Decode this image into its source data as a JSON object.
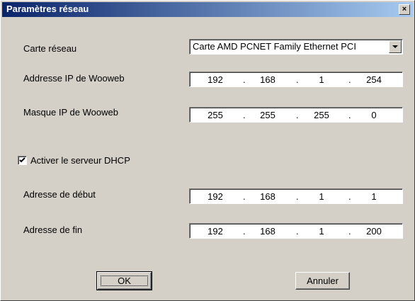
{
  "window": {
    "title": "Paramètres réseau",
    "close_glyph": "×"
  },
  "network_card": {
    "label": "Carte réseau",
    "value": "Carte AMD PCNET Family Ethernet PCI"
  },
  "ip_address": {
    "label": "Addresse IP de Wooweb",
    "octets": [
      "192",
      "168",
      "1",
      "254"
    ]
  },
  "ip_mask": {
    "label": "Masque IP de Wooweb",
    "octets": [
      "255",
      "255",
      "255",
      "0"
    ]
  },
  "dhcp": {
    "label": "Activer le serveur DHCP",
    "checked": true
  },
  "start_address": {
    "label": "Adresse de début",
    "octets": [
      "192",
      "168",
      "1",
      "1"
    ]
  },
  "end_address": {
    "label": "Adresse de fin",
    "octets": [
      "192",
      "168",
      "1",
      "200"
    ]
  },
  "buttons": {
    "ok": "OK",
    "cancel": "Annuler"
  },
  "icons": {
    "close": "close-icon",
    "dropdown": "chevron-down-icon",
    "check": "check-icon"
  },
  "colors": {
    "titlebar_start": "#0a246a",
    "titlebar_end": "#a6caf0",
    "face": "#d4d0c8"
  }
}
